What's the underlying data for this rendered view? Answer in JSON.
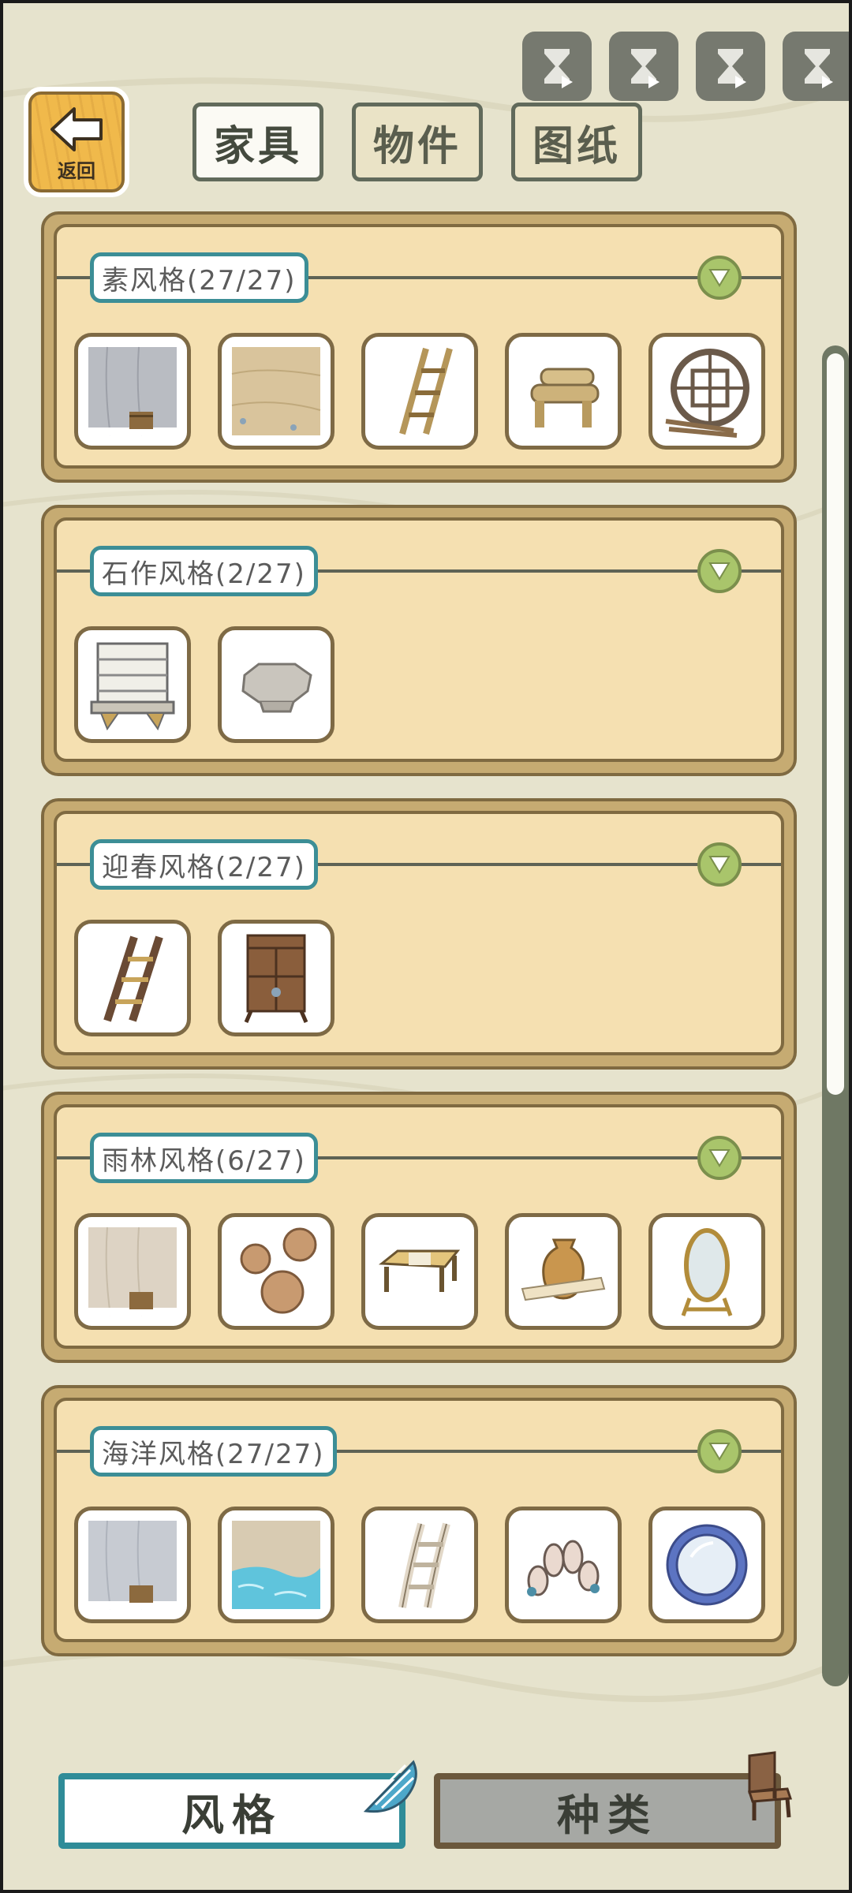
{
  "back_button": {
    "label": "返回"
  },
  "top_tabs": [
    {
      "label": "家具",
      "active": true
    },
    {
      "label": "物件",
      "active": false
    },
    {
      "label": "图纸",
      "active": false
    }
  ],
  "timers": [
    "hourglass-icon",
    "hourglass-icon",
    "hourglass-icon",
    "hourglass-icon"
  ],
  "sections": [
    {
      "title": "素风格(27/27)",
      "items": [
        "gray-wall-with-bucket",
        "sand-floor",
        "wooden-ladder",
        "log-bench",
        "round-lattice-window"
      ]
    },
    {
      "title": "石作风格(2/27)",
      "items": [
        "stone-shelf",
        "stone-table"
      ]
    },
    {
      "title": "迎春风格(2/27)",
      "items": [
        "brown-ladder",
        "wooden-cabinet"
      ]
    },
    {
      "title": "雨林风格(6/27)",
      "items": [
        "beige-wall-with-bucket",
        "round-wood-stools",
        "bamboo-bench",
        "clay-jar-scroll",
        "standing-mirror"
      ]
    },
    {
      "title": "海洋风格(27/27)",
      "items": [
        "blue-wall-with-bucket",
        "sea-water-floor",
        "driftwood-ladder",
        "coral-stones",
        "porthole-window"
      ]
    }
  ],
  "bottom_tabs": {
    "style_label": "风格",
    "type_label": "种类"
  },
  "colors": {
    "accent_teal": "#2f8c98",
    "panel": "#f5e0b1",
    "panel_border": "#7f6a41",
    "collapse_green": "#a9c56b"
  }
}
